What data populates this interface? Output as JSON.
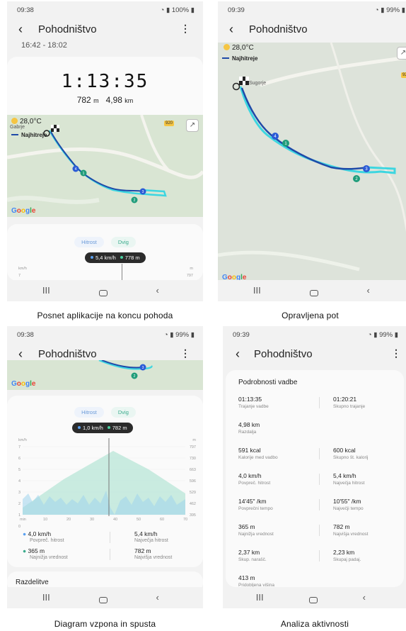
{
  "app": {
    "title": "Pohodništvo",
    "back_icon": "back-arrow-icon",
    "more_icon": "more-vert-icon"
  },
  "screens": [
    {
      "caption": "Posnet aplikacije na koncu pohoda",
      "status": {
        "time": "09:38",
        "battery": "100%"
      },
      "time_range": "16:42 - 18:02",
      "duration": "1:13:35",
      "elevation": "782",
      "elevation_unit": "m",
      "distance": "4,98",
      "distance_unit": "km",
      "map": {
        "temperature": "28,0°C",
        "place": "Gabrje",
        "legend": "Najhitreje",
        "road_badge": "920",
        "logo": "Google"
      },
      "tabs": {
        "speed": "Hitrost",
        "altitude": "Dvig"
      },
      "tooltip": {
        "speed": "5,4 km/h",
        "altitude": "778 m"
      },
      "axis": {
        "left_unit": "km/h",
        "right_unit": "m",
        "left_top": "7",
        "right_top": "797"
      }
    },
    {
      "caption": "Opravljena pot",
      "status": {
        "time": "09:39",
        "battery": "99%"
      },
      "map": {
        "temperature": "28,0°C",
        "legend": "Najhitreje",
        "place": "Sugorje",
        "road_badge": "920",
        "logo": "Google"
      }
    },
    {
      "caption": "Diagram vzpona in spusta",
      "status": {
        "time": "09:38",
        "battery": "99%"
      },
      "map": {
        "logo": "Google"
      },
      "tabs": {
        "speed": "Hitrost",
        "altitude": "Dvig"
      },
      "tooltip": {
        "speed": "1,0 km/h",
        "altitude": "782 m"
      },
      "axis": {
        "left_unit": "km/h",
        "right_unit": "m",
        "left_ticks": [
          "7",
          "6",
          "5",
          "4",
          "3",
          "2",
          "1",
          "0"
        ],
        "right_ticks": [
          "797",
          "730",
          "663",
          "596",
          "529",
          "462",
          "395"
        ],
        "x_ticks": [
          "min",
          "10",
          "20",
          "30",
          "40",
          "50",
          "60",
          "70"
        ]
      },
      "stats": [
        {
          "value": "4,0 km/h",
          "label": "Povpreč. hitrost"
        },
        {
          "value": "5,4 km/h",
          "label": "Največja hitrost"
        },
        {
          "value": "365 m",
          "label": "Najnižja vrednost"
        },
        {
          "value": "782 m",
          "label": "Najvišja vrednost"
        }
      ],
      "section": "Razdelitve"
    },
    {
      "caption": "Analiza aktivnosti",
      "status": {
        "time": "09:39",
        "battery": "99%"
      },
      "details_title": "Podrobnosti vadbe",
      "details": [
        {
          "value": "01:13:35",
          "label": "Trajanje vadbe"
        },
        {
          "value": "01:20:21",
          "label": "Skupno trajanje"
        },
        {
          "value": "4,98 km",
          "label": "Razdalja"
        },
        {
          "value": "591 kcal",
          "label": "Kalorije med vadbo"
        },
        {
          "value": "600 kcal",
          "label": "Skupno št. kalorij"
        },
        {
          "value": "4,0 km/h",
          "label": "Povpreč. hitrost"
        },
        {
          "value": "5,4 km/h",
          "label": "Največja hitrost"
        },
        {
          "value": "14'45\" /km",
          "label": "Povprečni tempo"
        },
        {
          "value": "10'55\" /km",
          "label": "Največji tempo"
        },
        {
          "value": "365 m",
          "label": "Najnižja vrednost"
        },
        {
          "value": "782 m",
          "label": "Najvišja vrednost"
        },
        {
          "value": "2,37 km",
          "label": "Skup. narašč."
        },
        {
          "value": "2,23 km",
          "label": "Skupaj padaj."
        },
        {
          "value": "413 m",
          "label": "Pridobljena višina"
        }
      ]
    }
  ],
  "colors": {
    "route_light": "#3dd6e0",
    "route_dark": "#1f4aa8",
    "marker_green": "#1f9c7a",
    "marker_blue": "#2b5bd6"
  }
}
